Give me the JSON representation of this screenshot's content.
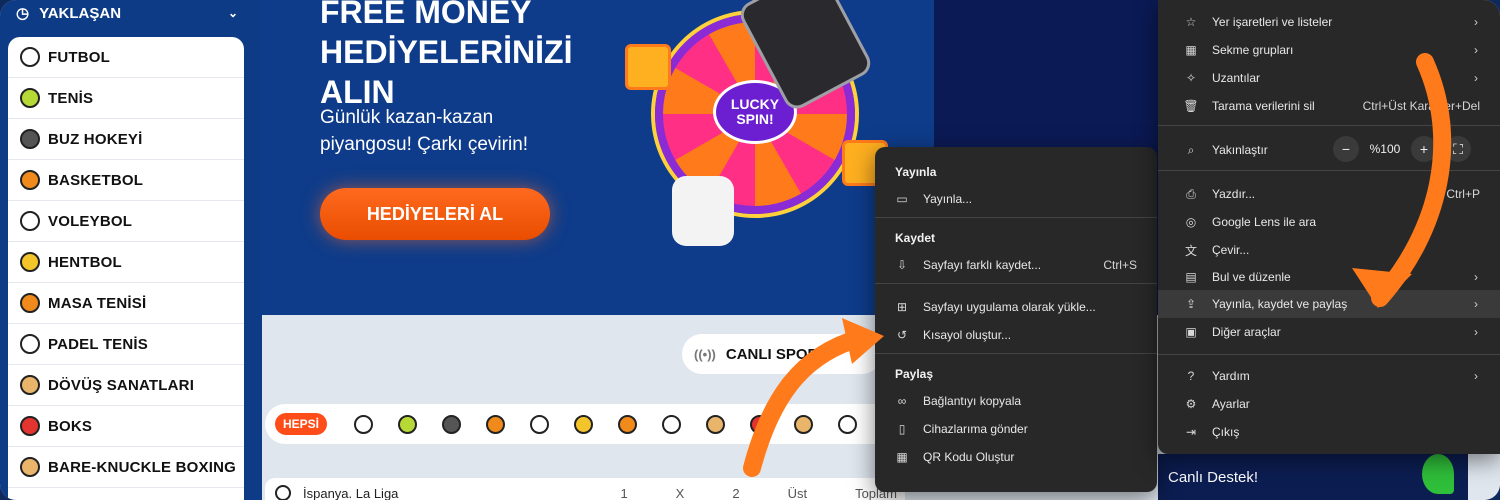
{
  "sidebar": {
    "header": "YAKLAŞAN",
    "items": [
      {
        "label": "FUTBOL",
        "icon": "soccer-ball-icon"
      },
      {
        "label": "TENİS",
        "icon": "tennis-ball-icon"
      },
      {
        "label": "BUZ HOKEYİ",
        "icon": "hockey-puck-icon"
      },
      {
        "label": "BASKETBOL",
        "icon": "basketball-icon"
      },
      {
        "label": "VOLEYBOL",
        "icon": "volleyball-icon"
      },
      {
        "label": "HENTBOL",
        "icon": "handball-icon"
      },
      {
        "label": "MASA TENİSİ",
        "icon": "table-tennis-icon"
      },
      {
        "label": "PADEL TENİS",
        "icon": "padel-racket-icon"
      },
      {
        "label": "DÖVÜŞ SANATLARI",
        "icon": "martial-arts-icon"
      },
      {
        "label": "BOKS",
        "icon": "boxing-glove-icon"
      },
      {
        "label": "BARE-KNUCKLE BOXING",
        "icon": "bare-knuckle-icon"
      }
    ]
  },
  "banner": {
    "title": "FREE MONEY HEDİYELERİNİZİ ALIN",
    "subtitle": "Günlük kazan-kazan piyangosu! Çarkı çevirin!",
    "button": "HEDİYELERİ AL",
    "wheel_label": "LUCKY SPIN!"
  },
  "content": {
    "live_label": "CANLI SPOR",
    "filter_all": "HEPSİ",
    "filter_icons": [
      "soccer-ball-icon",
      "tennis-ball-icon",
      "hockey-puck-icon",
      "basketball-icon",
      "volleyball-icon",
      "handball-icon",
      "table-tennis-icon",
      "padel-racket-icon",
      "martial-arts-icon",
      "boxing-glove-icon",
      "bare-knuckle-icon",
      "badminton-icon"
    ],
    "league": "İspanya. La Liga",
    "cols": [
      "1",
      "X",
      "2",
      "Üst",
      "Toplam"
    ],
    "chat": "Canlı Destek!"
  },
  "menu_main": {
    "items": [
      {
        "label": "Yer işaretleri ve listeler",
        "icon": "star-icon",
        "arrow": true
      },
      {
        "label": "Sekme grupları",
        "icon": "tab-groups-icon",
        "arrow": true
      },
      {
        "label": "Uzantılar",
        "icon": "puzzle-icon",
        "arrow": true
      },
      {
        "label": "Tarama verilerini sil",
        "icon": "trash-icon",
        "shortcut": "Ctrl+Üst Karakter+Del"
      },
      {
        "label": "Yakınlaştır",
        "icon": "zoom-icon"
      },
      {
        "label": "Yazdır...",
        "icon": "printer-icon",
        "shortcut": "Ctrl+P"
      },
      {
        "label": "Google Lens ile ara",
        "icon": "lens-icon"
      },
      {
        "label": "Çevir...",
        "icon": "translate-icon"
      },
      {
        "label": "Bul ve düzenle",
        "icon": "find-icon",
        "arrow": true
      },
      {
        "label": "Yayınla, kaydet ve paylaş",
        "icon": "share-file-icon",
        "arrow": true
      },
      {
        "label": "Diğer araçlar",
        "icon": "toolbox-icon",
        "arrow": true
      },
      {
        "label": "Yardım",
        "icon": "help-icon",
        "arrow": true
      },
      {
        "label": "Ayarlar",
        "icon": "gear-icon"
      },
      {
        "label": "Çıkış",
        "icon": "exit-icon"
      }
    ],
    "zoom_value": "%100"
  },
  "menu_sub": {
    "sections": [
      {
        "heading": "Yayınla",
        "items": [
          {
            "label": "Yayınla...",
            "icon": "cast-icon"
          }
        ]
      },
      {
        "heading": "Kaydet",
        "items": [
          {
            "label": "Sayfayı farklı kaydet...",
            "icon": "save-page-icon",
            "shortcut": "Ctrl+S"
          }
        ]
      },
      {
        "heading": "",
        "items": [
          {
            "label": "Sayfayı uygulama olarak yükle...",
            "icon": "install-app-icon"
          },
          {
            "label": "Kısayol oluştur...",
            "icon": "shortcut-icon"
          }
        ]
      },
      {
        "heading": "Paylaş",
        "items": [
          {
            "label": "Bağlantıyı kopyala",
            "icon": "link-icon"
          },
          {
            "label": "Cihazlarıma gönder",
            "icon": "devices-icon"
          },
          {
            "label": "QR Kodu Oluştur",
            "icon": "qr-code-icon"
          }
        ]
      }
    ]
  },
  "colors": {
    "accent": "#ff6a1f",
    "sidebar": "#0d3b86",
    "menu_bg": "#282828",
    "arrow": "#ff7a1a"
  }
}
